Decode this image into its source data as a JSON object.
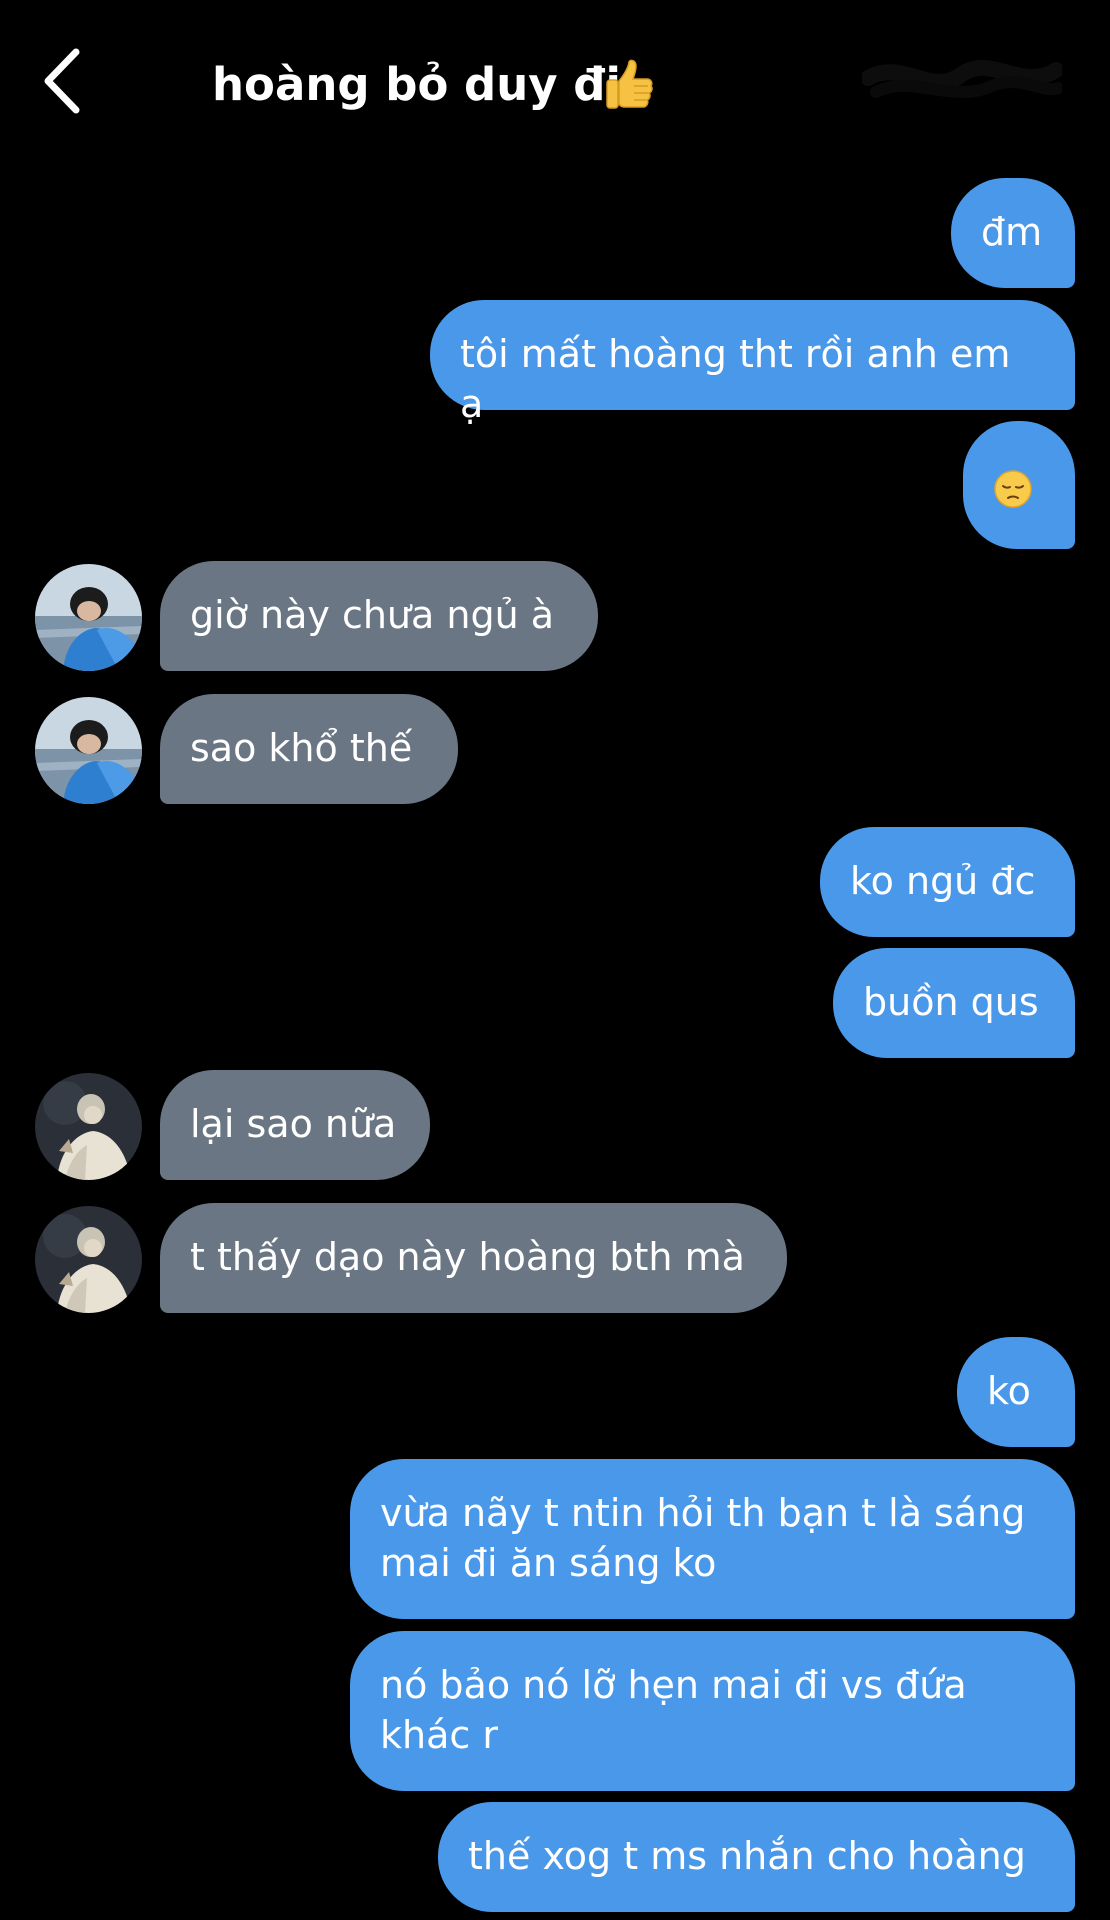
{
  "header": {
    "title": "hoàng bỏ duy đi",
    "title_emoji": "thumbs-up-icon",
    "back_icon": "chevron-left-icon"
  },
  "colors": {
    "background": "#000000",
    "outgoing_bubble": "#4a98e9",
    "incoming_bubble": "#6a7683",
    "text": "#ffffff"
  },
  "messages": [
    {
      "direction": "outgoing",
      "text": "đm"
    },
    {
      "direction": "outgoing",
      "text": "tôi mất hoàng tht rồi anh em ạ"
    },
    {
      "direction": "outgoing",
      "text": "",
      "emoji": "pensive-face-icon"
    },
    {
      "direction": "incoming",
      "sender_avatar": "avatar-1",
      "text": "giờ này chưa ngủ à"
    },
    {
      "direction": "incoming",
      "sender_avatar": "avatar-1",
      "text": "sao khổ thế"
    },
    {
      "direction": "outgoing",
      "text": "ko ngủ đc"
    },
    {
      "direction": "outgoing",
      "text": "buồn qus"
    },
    {
      "direction": "incoming",
      "sender_avatar": "avatar-2",
      "text": "lại sao nữa"
    },
    {
      "direction": "incoming",
      "sender_avatar": "avatar-2",
      "text": "t thấy dạo này hoàng bth mà"
    },
    {
      "direction": "outgoing",
      "text": "ko"
    },
    {
      "direction": "outgoing",
      "text": "vừa nãy t ntin hỏi th bạn t là sáng\nmai đi ăn sáng ko"
    },
    {
      "direction": "outgoing",
      "text": "nó bảo nó lỡ hẹn mai đi vs đứa\nkhác r"
    },
    {
      "direction": "outgoing",
      "text": "thế xog t ms nhắn cho hoàng"
    }
  ]
}
